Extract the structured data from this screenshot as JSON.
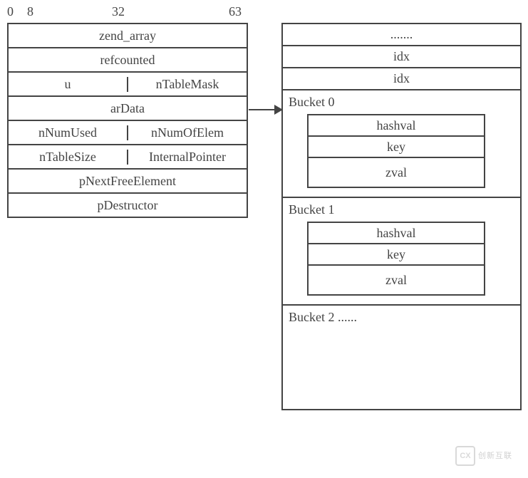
{
  "bits": {
    "b0": "0",
    "b8": "8",
    "b32": "32",
    "b63": "63"
  },
  "left": {
    "title": "zend_array",
    "refcounted": "refcounted",
    "u": "u",
    "nTableMask": "nTableMask",
    "arData": "arData",
    "nNumUsed": "nNumUsed",
    "nNumOfElem": "nNumOfElem",
    "nTableSize": "nTableSize",
    "InternalPointer": "InternalPointer",
    "pNextFreeElement": "pNextFreeElement",
    "pDestructor": "pDestructor"
  },
  "right": {
    "ellipsis": ".......",
    "idx1": "idx",
    "idx2": "idx",
    "bucket0": "Bucket 0",
    "bucket1": "Bucket 1",
    "bucket2": "Bucket 2 ......",
    "inner": {
      "hashval": "hashval",
      "key": "key",
      "zval": "zval"
    }
  },
  "watermark": {
    "brand": "CX",
    "text": "创新互联"
  }
}
